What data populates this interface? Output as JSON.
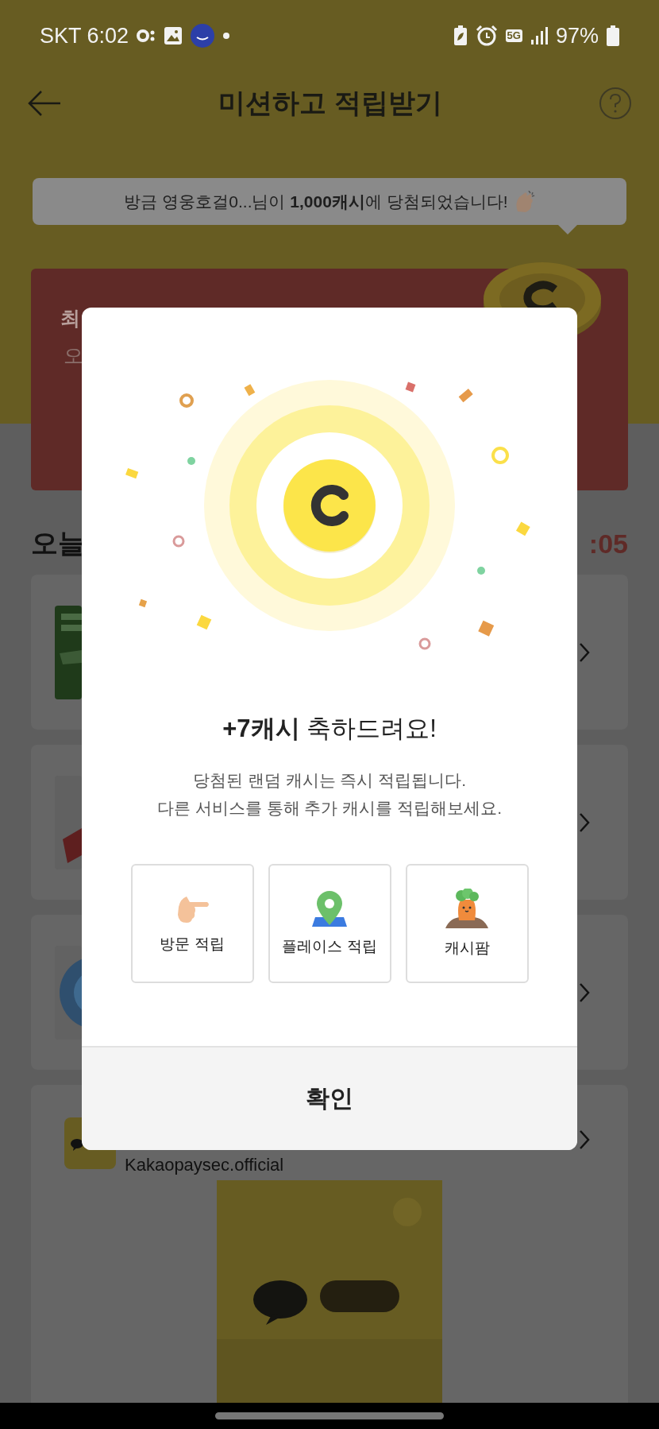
{
  "status_bar": {
    "carrier": "SKT",
    "time": "6:02",
    "network": "5G",
    "battery": "97%"
  },
  "header": {
    "title": "미션하고 적립받기"
  },
  "ticker": {
    "text": "방금 영웅호걸0...님이 **1,000캐시**에 당첨되었습니다!"
  },
  "banner": {
    "title": "최",
    "subtitle": "오"
  },
  "section": {
    "title": "오늘",
    "timer": ":05"
  },
  "sponsor": {
    "account": "Kakaopaysec.official"
  },
  "dialog": {
    "title": "**+7캐시** 축하드려요!",
    "description": [
      "당첨된 랜덤 캐시는 즉시 적립됩니다.",
      "다른 서비스를 통해 추가 캐시를 적립해보세요."
    ],
    "services": [
      {
        "kind": "visit",
        "label": "방문 적립"
      },
      {
        "kind": "place",
        "label": "플레이스 적립"
      },
      {
        "kind": "farm",
        "label": "캐시팜"
      }
    ],
    "confirm": "확인"
  }
}
